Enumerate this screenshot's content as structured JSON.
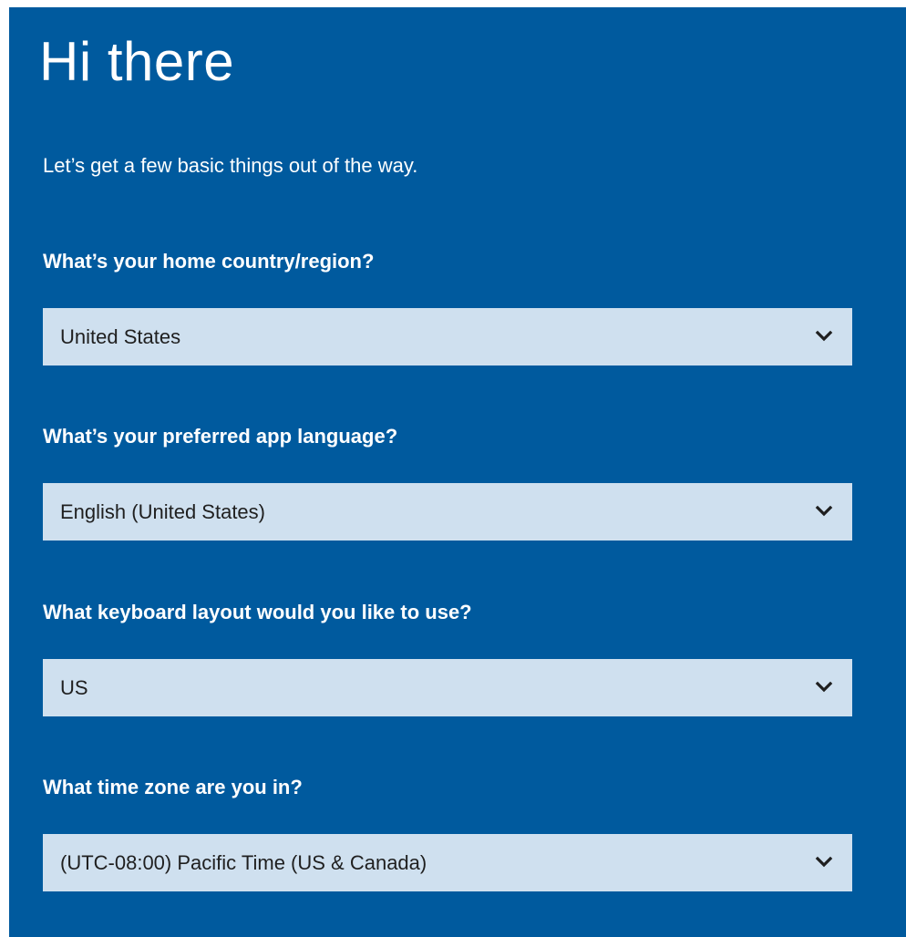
{
  "page": {
    "title": "Hi there",
    "subtitle": "Let’s get a few basic things out of the way."
  },
  "questions": [
    {
      "label": "What’s your home country/region?",
      "value": "United States",
      "icon": "chevron-down-icon"
    },
    {
      "label": "What’s your preferred app language?",
      "value": "English (United States)",
      "icon": "chevron-down-icon"
    },
    {
      "label": "What keyboard layout would you like to use?",
      "value": "US",
      "icon": "chevron-down-icon"
    },
    {
      "label": "What time zone are you in?",
      "value": "(UTC-08:00) Pacific Time (US & Canada)",
      "icon": "chevron-down-icon"
    }
  ],
  "colors": {
    "background": "#005a9e",
    "select_background": "#cfe0ef",
    "text_light": "#ffffff",
    "text_dark": "#1f1f1f"
  }
}
